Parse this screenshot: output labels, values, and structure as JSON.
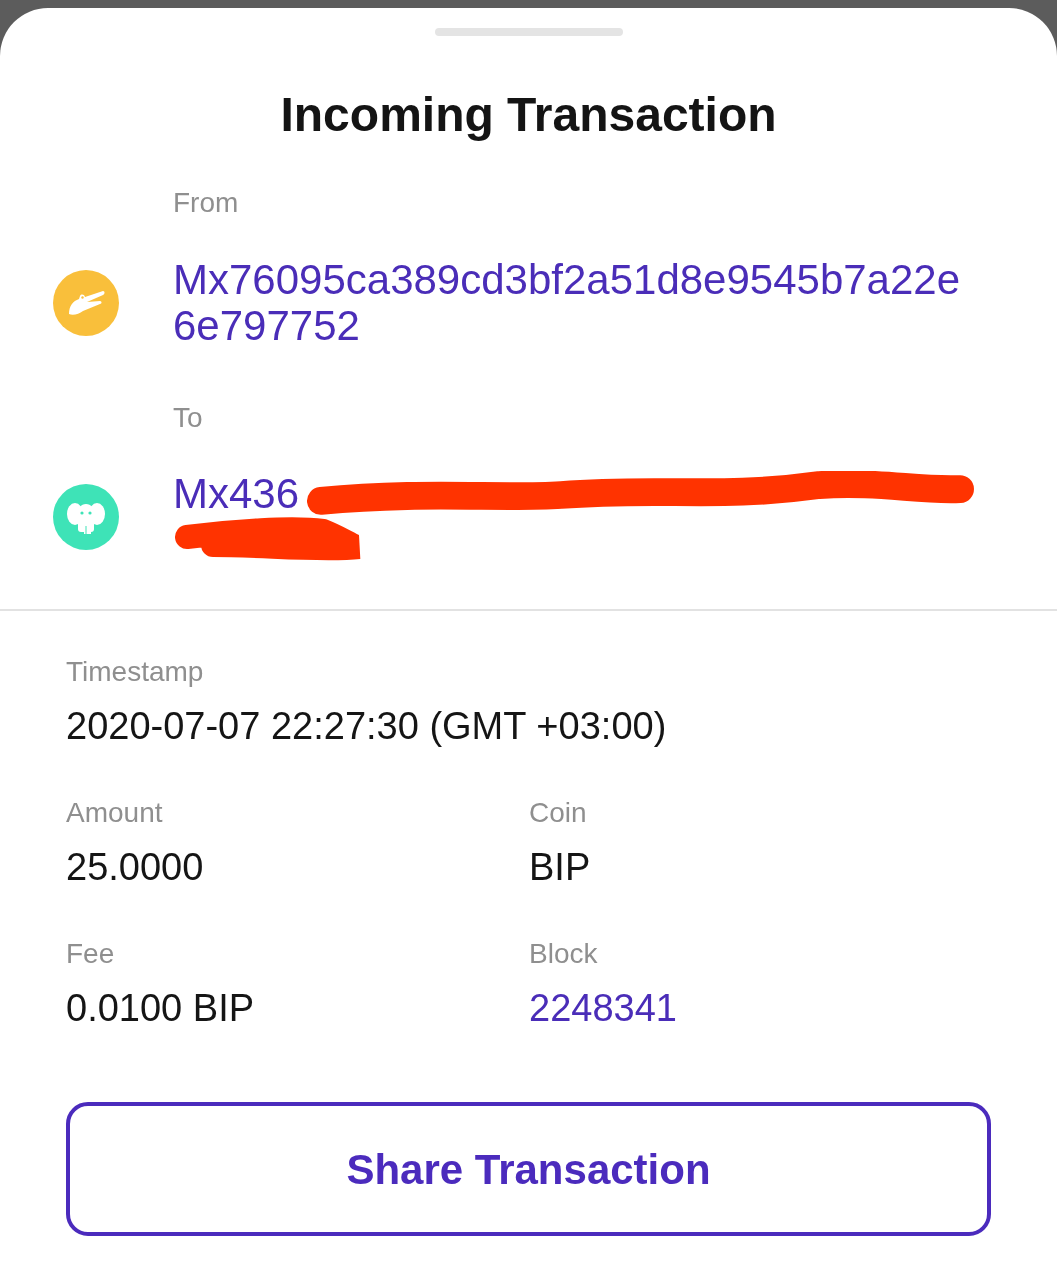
{
  "sheet": {
    "title": "Incoming Transaction"
  },
  "parties": [
    {
      "label": "From",
      "kind": "crocodile",
      "color": "#f9bf3b",
      "address": "Mx76095ca389cd3bf2a51d8e9545b7a22e6e797752",
      "redacted": false
    },
    {
      "label": "To",
      "kind": "elephant",
      "color": "#3ee3b7",
      "address": "Mx436",
      "redacted": true
    }
  ],
  "timestamp": {
    "label": "Timestamp",
    "value": "2020-07-07 22:27:30 (GMT +03:00)"
  },
  "details": [
    {
      "label": "Amount",
      "value": "25.0000",
      "kind": "text"
    },
    {
      "label": "Coin",
      "value": "BIP",
      "kind": "text"
    },
    {
      "label": "Fee",
      "value": "0.0100 BIP",
      "kind": "text"
    },
    {
      "label": "Block",
      "value": "2248341",
      "kind": "link"
    }
  ],
  "button": {
    "label": "Share Transaction"
  }
}
